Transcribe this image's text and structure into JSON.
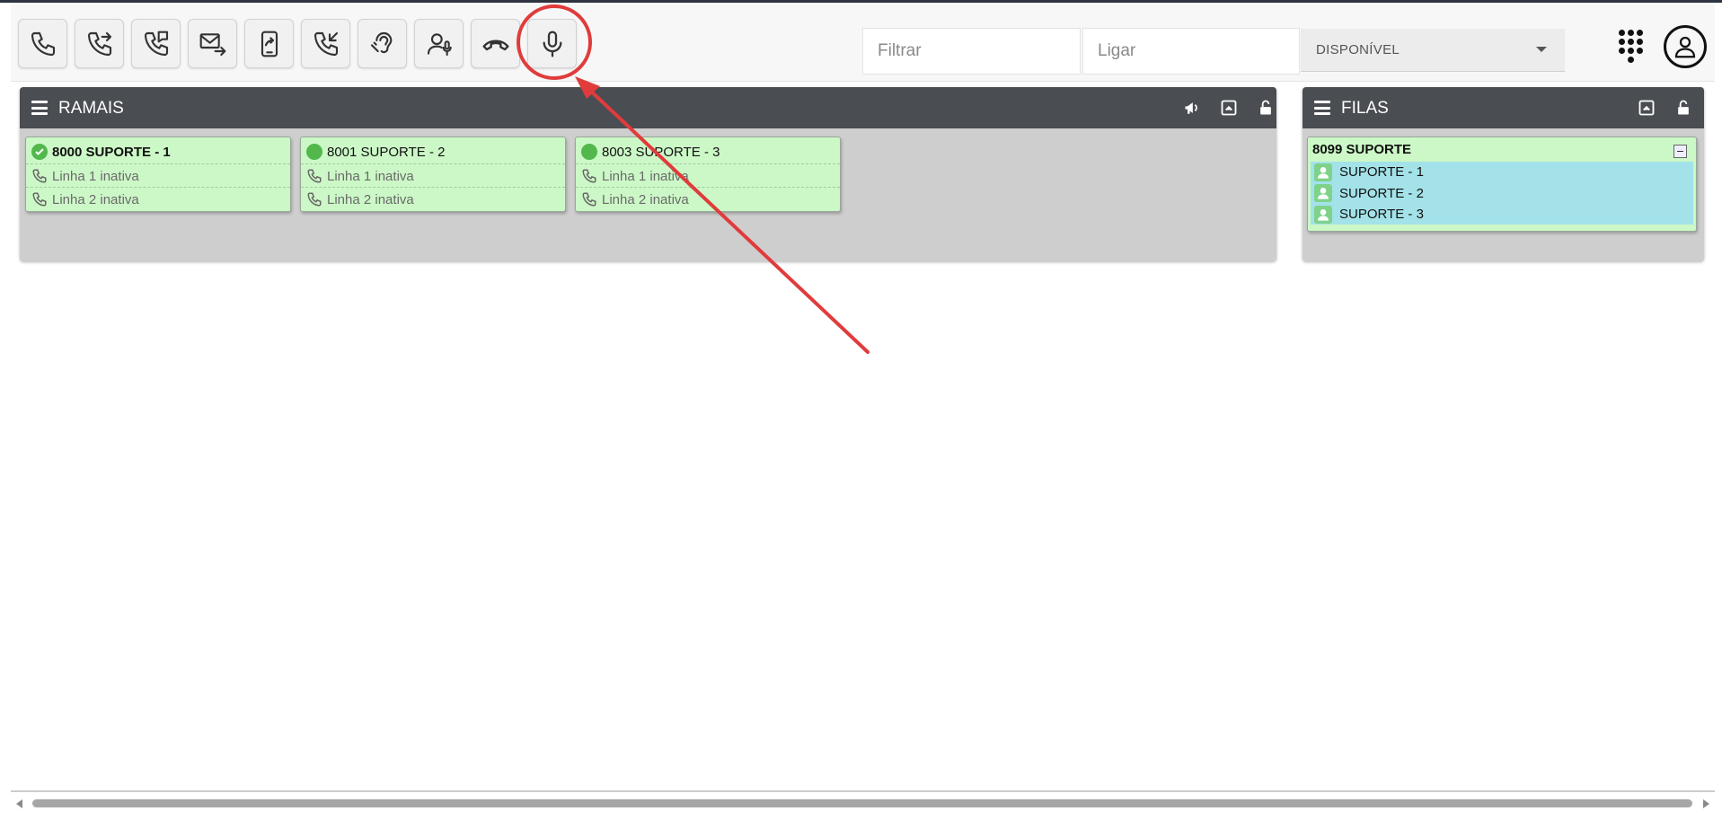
{
  "toolbar": {
    "buttons": [
      {
        "name": "call-icon"
      },
      {
        "name": "transfer-call-icon"
      },
      {
        "name": "attended-transfer-icon"
      },
      {
        "name": "voicemail-forward-icon"
      },
      {
        "name": "mobile-forward-icon"
      },
      {
        "name": "pickup-call-icon"
      },
      {
        "name": "listen-ear-icon"
      },
      {
        "name": "conference-user-icon"
      },
      {
        "name": "hangup-icon"
      },
      {
        "name": "microphone-icon"
      }
    ],
    "filter_placeholder": "Filtrar",
    "dial_placeholder": "Ligar",
    "status_value": "DISPONÍVEL"
  },
  "ramais": {
    "title": "RAMAIS",
    "cards": [
      {
        "title": "8000 SUPORTE - 1",
        "line1": "Linha 1 inativa",
        "line2": "Linha 2 inativa"
      },
      {
        "title": "8001 SUPORTE - 2",
        "line1": "Linha 1 inativa",
        "line2": "Linha 2 inativa"
      },
      {
        "title": "8003 SUPORTE - 3",
        "line1": "Linha 1 inativa",
        "line2": "Linha 2 inativa"
      }
    ]
  },
  "filas": {
    "title": "FILAS",
    "queue": {
      "title": "8099 SUPORTE",
      "members": [
        "SUPORTE - 1",
        "SUPORTE - 2",
        "SUPORTE - 3"
      ]
    }
  },
  "colors": {
    "panel_header": "#4a4d52",
    "card_green": "#ccf8c7",
    "status_green": "#52b84c",
    "queue_list": "#a3e2e8",
    "annotation_red": "#e03c3c"
  }
}
